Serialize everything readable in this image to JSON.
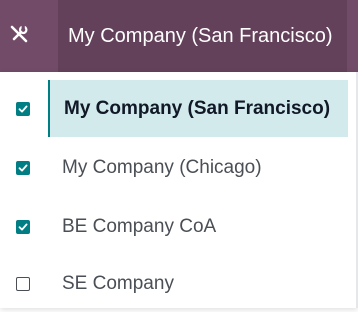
{
  "topbar": {
    "current_company": "My Company (San Francisco)",
    "tools_icon": "tools-icon"
  },
  "companies": [
    {
      "label": "My Company (San Francisco)",
      "checked": true,
      "active": true
    },
    {
      "label": "My Company (Chicago)",
      "checked": true,
      "active": false
    },
    {
      "label": "BE Company CoA",
      "checked": true,
      "active": false
    },
    {
      "label": "SE Company",
      "checked": false,
      "active": false
    }
  ],
  "colors": {
    "topbar_bg": "#714B67",
    "checkbox_checked": "#017E84",
    "active_row_bg": "#D2EAEB"
  }
}
